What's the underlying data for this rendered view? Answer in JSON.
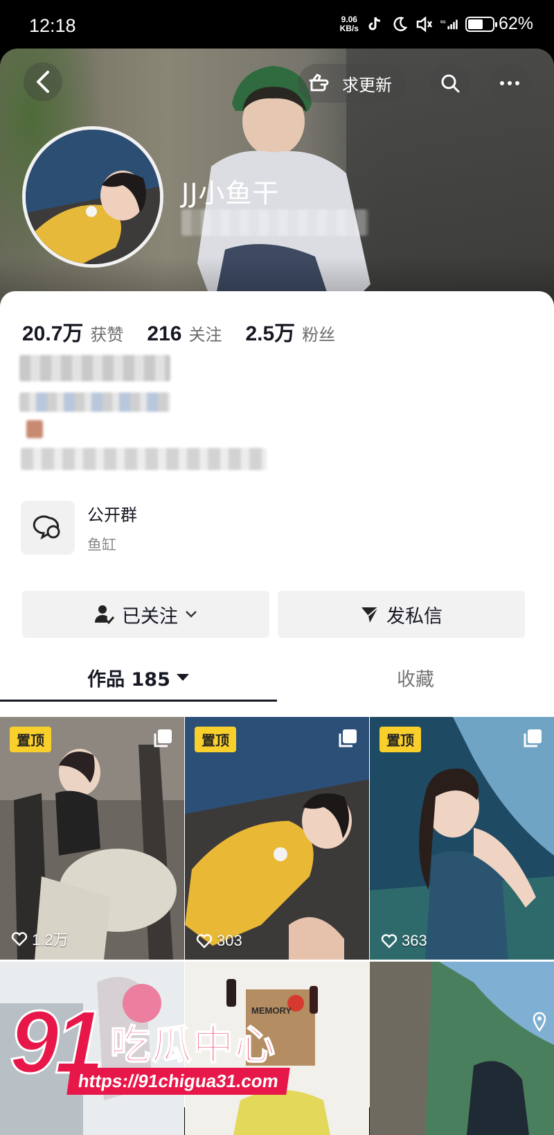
{
  "status_bar": {
    "time": "12:18",
    "net_speed_value": "9.06",
    "net_speed_unit": "KB/s",
    "network": "5G",
    "battery": "62%",
    "battery_level": 0.62
  },
  "header": {
    "request_update_label": "求更新",
    "username": "JJ小鱼干"
  },
  "stats": [
    {
      "value": "20.7万",
      "label": "获赞"
    },
    {
      "value": "216",
      "label": "关注"
    },
    {
      "value": "2.5万",
      "label": "粉丝"
    }
  ],
  "group": {
    "title": "公开群",
    "subtitle": "鱼缸"
  },
  "actions": {
    "followed_label": "已关注",
    "message_label": "发私信"
  },
  "tabs": {
    "works_label": "作品 185",
    "favorites_label": "收藏"
  },
  "grid": {
    "pinned_label": "置顶",
    "items": [
      {
        "likes": "1.2万",
        "pinned": true
      },
      {
        "likes": "303",
        "pinned": true
      },
      {
        "likes": "363",
        "pinned": true
      }
    ],
    "poster_text_1": "MEMORY"
  },
  "watermark": {
    "number": "91",
    "name": "吃瓜中心",
    "url": "https://91chigua31.com"
  },
  "colors": {
    "pin_badge": "#f9cf2c",
    "watermark_red": "#e8174a",
    "text_primary": "#161823"
  }
}
